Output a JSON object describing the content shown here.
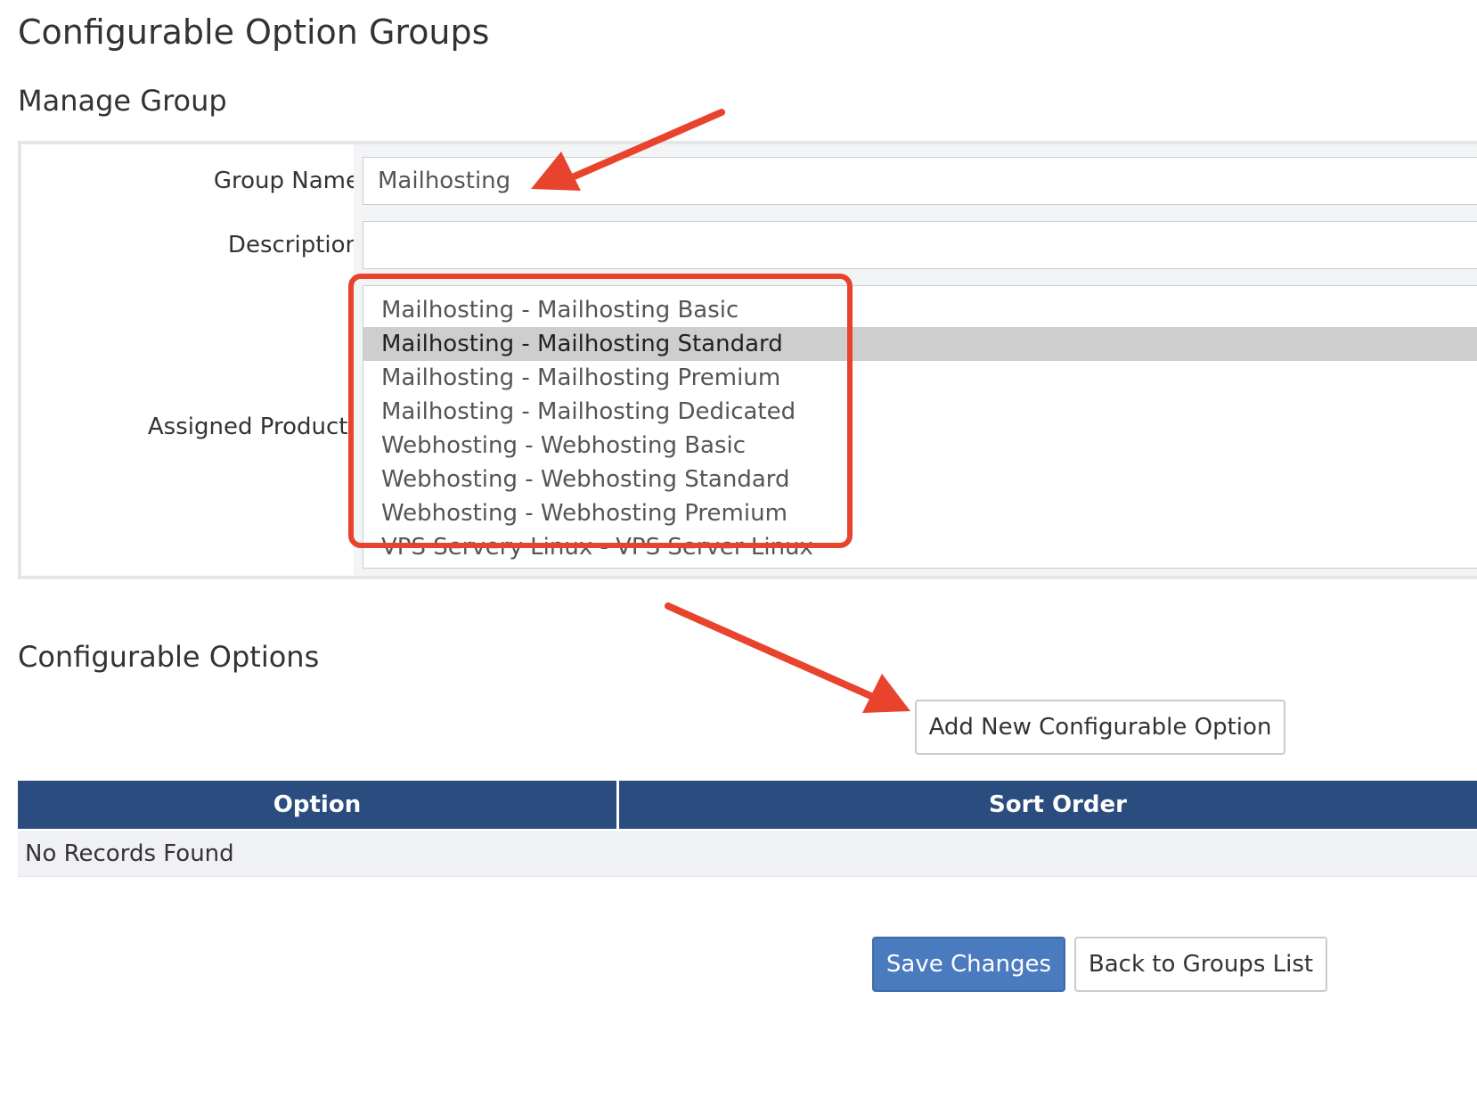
{
  "page": {
    "title": "Configurable Option Groups"
  },
  "manage_group": {
    "heading": "Manage Group",
    "group_name_label": "Group Name",
    "group_name_value": "Mailhosting",
    "description_label": "Description",
    "description_value": "",
    "assigned_products_label": "Assigned Products",
    "assigned_products_options": [
      {
        "label": "Mailhosting - Mailhosting Basic",
        "selected": false
      },
      {
        "label": "Mailhosting - Mailhosting Standard",
        "selected": true
      },
      {
        "label": "Mailhosting - Mailhosting Premium",
        "selected": false
      },
      {
        "label": "Mailhosting - Mailhosting Dedicated",
        "selected": false
      },
      {
        "label": "Webhosting - Webhosting Basic",
        "selected": false
      },
      {
        "label": "Webhosting - Webhosting Standard",
        "selected": false
      },
      {
        "label": "Webhosting - Webhosting Premium",
        "selected": false
      },
      {
        "label": "VPS Servery Linux - VPS Server Linux",
        "selected": false
      }
    ]
  },
  "configurable_options": {
    "heading": "Configurable Options",
    "add_button_label": "Add New Configurable Option",
    "table": {
      "columns": [
        "Option",
        "Sort Order"
      ],
      "empty_message": "No Records Found"
    }
  },
  "footer": {
    "save_label": "Save Changes",
    "back_label": "Back to Groups List"
  },
  "colors": {
    "annotation_red": "#e8432c",
    "table_header": "#2b4c7e",
    "primary_button": "#4a7bbf"
  }
}
